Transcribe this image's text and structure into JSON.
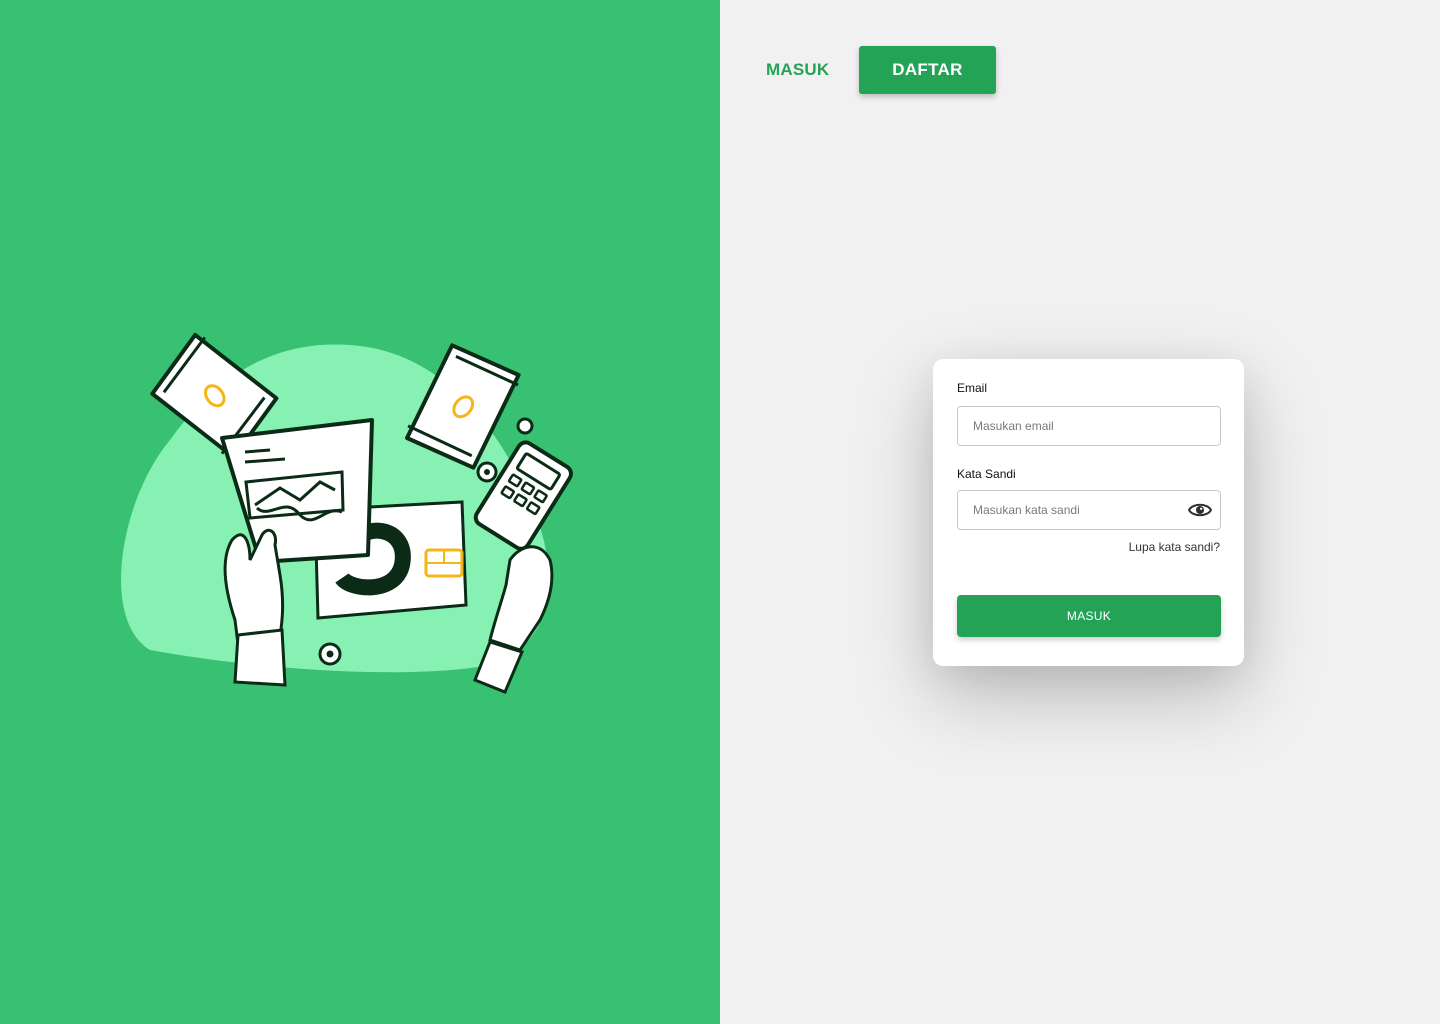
{
  "header": {
    "login_tab_label": "MASUK",
    "register_tab_label": "DAFTAR"
  },
  "login_form": {
    "email_label": "Email",
    "email_placeholder": "Masukan email",
    "password_label": "Kata Sandi",
    "password_placeholder": "Masukan kata sandi",
    "password_toggle_icon": "eye-icon",
    "forgot_password_label": "Lupa kata sandi?",
    "submit_label": "MASUK"
  },
  "illustration": {
    "subject": "finance-illustration"
  },
  "colors": {
    "brand_green": "#38c172",
    "button_green": "#24a357",
    "blob_light_green": "#86f1b2",
    "accent_yellow": "#f5b516",
    "page_background": "#f1f1f1"
  }
}
